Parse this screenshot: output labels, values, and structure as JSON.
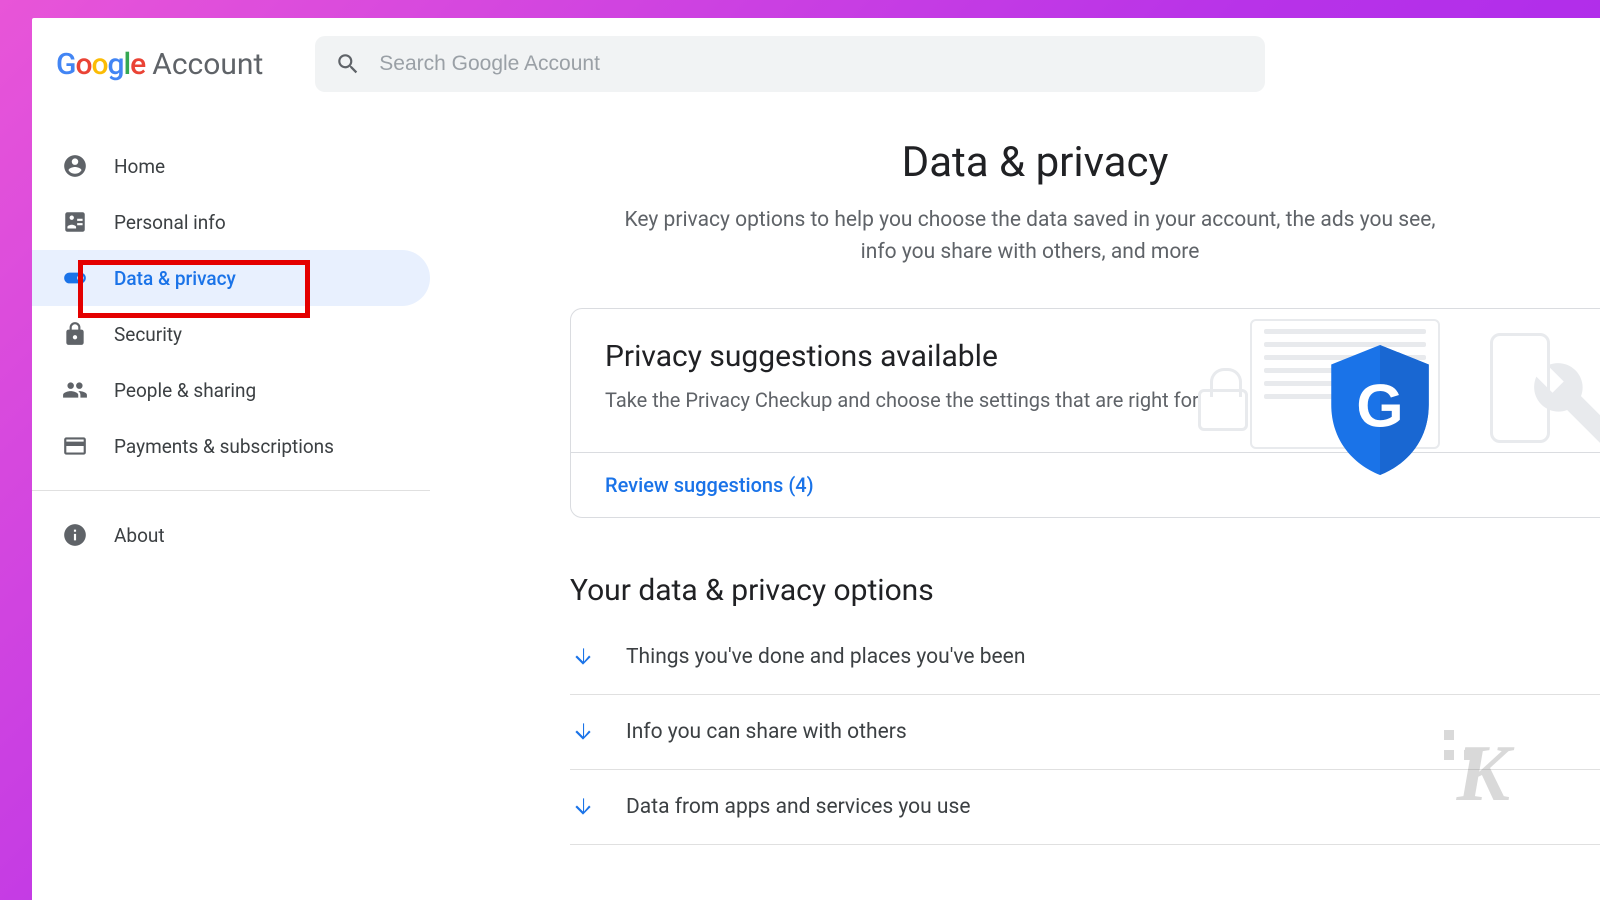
{
  "header": {
    "brand_word": "Account",
    "search_placeholder": "Search Google Account"
  },
  "sidebar": {
    "items": [
      {
        "label": "Home"
      },
      {
        "label": "Personal info"
      },
      {
        "label": "Data & privacy"
      },
      {
        "label": "Security"
      },
      {
        "label": "People & sharing"
      },
      {
        "label": "Payments & subscriptions"
      },
      {
        "label": "About"
      }
    ]
  },
  "main": {
    "title": "Data & privacy",
    "subtitle": "Key privacy options to help you choose the data saved in your account, the ads you see, info you share with others, and more",
    "card": {
      "title": "Privacy suggestions available",
      "desc": "Take the Privacy Checkup and choose the settings that are right for you",
      "review_link": "Review suggestions (4)"
    },
    "options": {
      "title": "Your data & privacy options",
      "rows": [
        "Things you've done and places you've been",
        "Info you can share with others",
        "Data from apps and services you use"
      ]
    }
  }
}
